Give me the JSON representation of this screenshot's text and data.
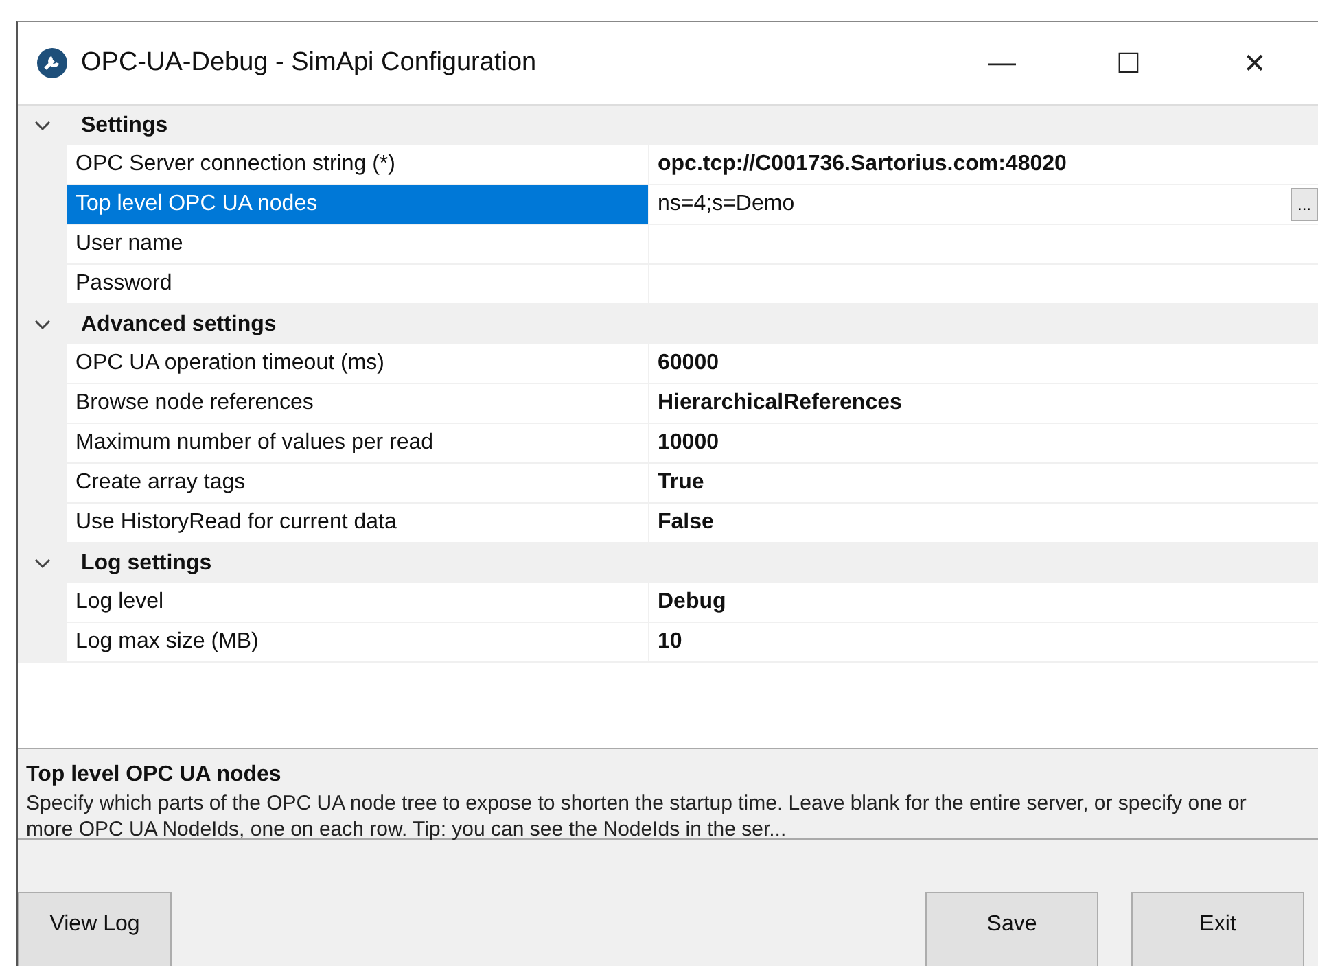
{
  "window": {
    "title": "OPC-UA-Debug - SimApi Configuration",
    "controls": [
      "—",
      "☐",
      "✕"
    ]
  },
  "categories": [
    {
      "name": "Settings",
      "expanded": true,
      "rows": [
        {
          "label": "OPC Server connection string (*)",
          "value": "opc.tcp://C001736.Sartorius.com:48020",
          "bold": true,
          "selected": false
        },
        {
          "label": "Top level OPC UA nodes",
          "value": "ns=4;s=Demo",
          "bold": false,
          "selected": true,
          "edit_button": "..."
        },
        {
          "label": "User name",
          "selected": false
        },
        {
          "label": "Password",
          "selected": false
        }
      ]
    },
    {
      "name": "Advanced settings",
      "expanded": true,
      "rows": [
        {
          "label": "OPC UA operation timeout (ms)",
          "value": "60000",
          "bold": true,
          "selected": false
        },
        {
          "label": "Browse node references",
          "value": "HierarchicalReferences",
          "bold": true,
          "selected": false
        },
        {
          "label": "Maximum number of values per read",
          "value": "10000",
          "bold": true,
          "selected": false
        },
        {
          "label": "Create array tags",
          "value": "True",
          "bold": true,
          "selected": false
        },
        {
          "label": "Use HistoryRead for current data",
          "value": "False",
          "bold": true,
          "selected": false
        }
      ]
    },
    {
      "name": "Log settings",
      "expanded": true,
      "rows": [
        {
          "label": "Log level",
          "value": "Debug",
          "bold": true,
          "selected": false
        },
        {
          "label": "Log max size (MB)",
          "value": "10",
          "bold": true,
          "selected": false
        }
      ]
    }
  ],
  "description": {
    "title": "Top level OPC UA nodes",
    "text": "Specify which parts of the OPC UA node tree to expose to shorten the startup time. Leave blank for the entire server, or specify one or more OPC UA NodeIds, one on each row. Tip: you can see the NodeIds in the ser..."
  },
  "buttons": {
    "left": [
      "View Log"
    ],
    "right": [
      "Save",
      "Exit"
    ]
  }
}
